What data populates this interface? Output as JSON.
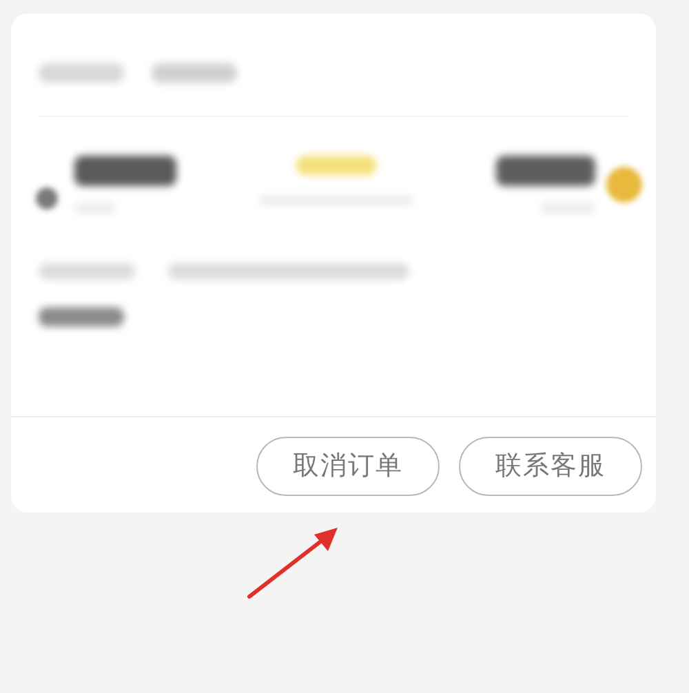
{
  "order_card": {
    "buttons": [
      {
        "label": "取消订单"
      },
      {
        "label": "联系客服"
      }
    ]
  }
}
